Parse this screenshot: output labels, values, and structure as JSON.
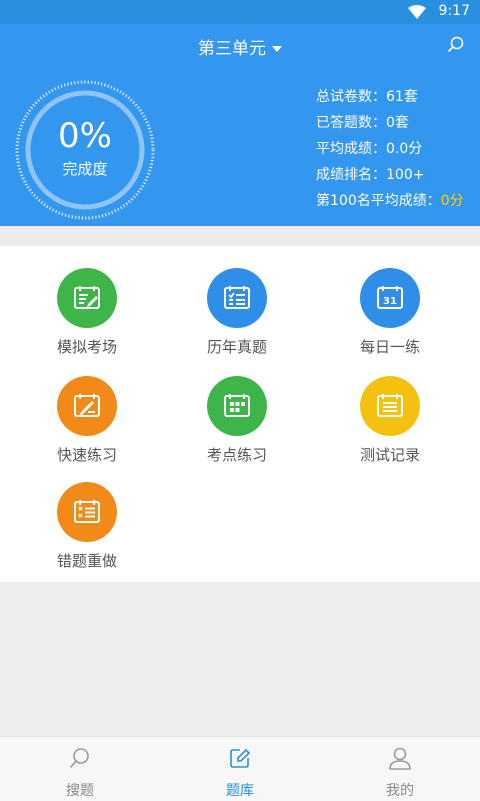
{
  "status_bar": {
    "time": "9:17"
  },
  "title_bar": {
    "title": "第三单元"
  },
  "progress": {
    "percent_text": "0%",
    "label": "完成度",
    "value": 0
  },
  "stats": [
    {
      "label": "总试卷数：",
      "value": "61套"
    },
    {
      "label": "已答题数：",
      "value": "0套"
    },
    {
      "label": "平均成绩：",
      "value": "0.0分"
    },
    {
      "label": "成绩排名：",
      "value": "100+"
    },
    {
      "label": "第100名平均成绩：",
      "value": "0分"
    }
  ],
  "menu": [
    {
      "label": "模拟考场",
      "icon": "exam-pencil-icon",
      "color": "#3db549"
    },
    {
      "label": "历年真题",
      "icon": "checklist-calendar-icon",
      "color": "#2f8fe8"
    },
    {
      "label": "每日一练",
      "icon": "calendar-31-icon",
      "color": "#2f8fe8"
    },
    {
      "label": "快速练习",
      "icon": "calendar-edit-icon",
      "color": "#f18a18"
    },
    {
      "label": "考点练习",
      "icon": "calendar-grid-icon",
      "color": "#3db549"
    },
    {
      "label": "测试记录",
      "icon": "calendar-list-icon",
      "color": "#f5c110"
    },
    {
      "label": "错题重做",
      "icon": "calendar-wrong-icon",
      "color": "#f18a18"
    }
  ],
  "tabs": [
    {
      "label": "搜题",
      "icon": "search-icon",
      "active": false
    },
    {
      "label": "题库",
      "icon": "edit-icon",
      "active": true
    },
    {
      "label": "我的",
      "icon": "user-icon",
      "active": false
    }
  ],
  "colors": {
    "primary": "#3396ef",
    "highlight": "#ffd200"
  }
}
